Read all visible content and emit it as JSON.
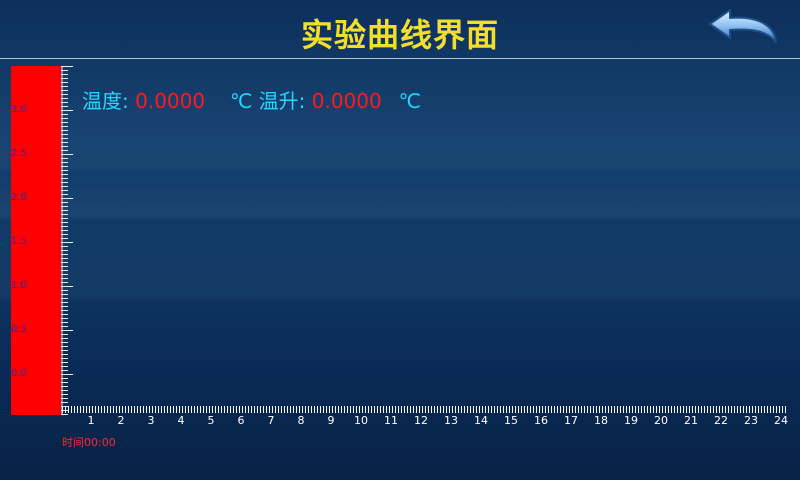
{
  "header": {
    "title": "实验曲线界面"
  },
  "readout": {
    "temp_label": "温度:",
    "temp_value": "0.0000",
    "temp_unit": "℃",
    "rise_label": "温升:",
    "rise_value": "0.0000",
    "rise_unit": "℃"
  },
  "y_axis": {
    "labels": [
      "3.0",
      "2.5",
      "2.0",
      "1.5",
      "1.0",
      "0.5",
      "0.0"
    ]
  },
  "x_axis": {
    "labels": [
      "1",
      "2",
      "3",
      "4",
      "5",
      "6",
      "7",
      "8",
      "9",
      "10",
      "11",
      "12",
      "13",
      "14",
      "15",
      "16",
      "17",
      "18",
      "19",
      "20",
      "21",
      "22",
      "23",
      "24"
    ]
  },
  "time": {
    "label": "时间00:00"
  },
  "colors": {
    "title": "#f3df2b",
    "accent": "#23d7ff",
    "value": "#ff1a1a",
    "bar": "#ff0000"
  }
}
